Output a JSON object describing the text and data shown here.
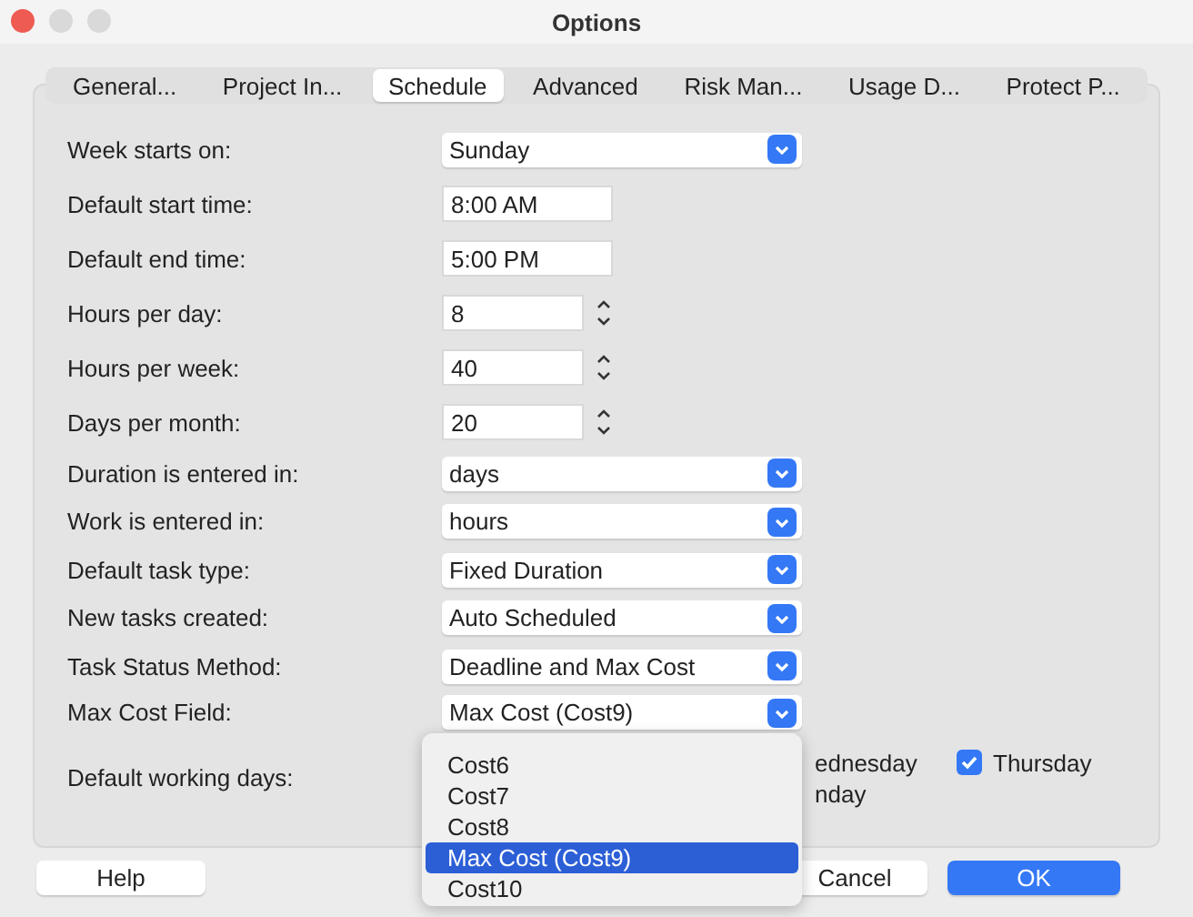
{
  "window": {
    "title": "Options"
  },
  "tabs": [
    {
      "label": "General...",
      "selected": false
    },
    {
      "label": "Project In...",
      "selected": false
    },
    {
      "label": "Schedule",
      "selected": true
    },
    {
      "label": "Advanced",
      "selected": false
    },
    {
      "label": "Risk Man...",
      "selected": false
    },
    {
      "label": "Usage D...",
      "selected": false
    },
    {
      "label": "Protect P...",
      "selected": false
    }
  ],
  "fields": [
    {
      "label": "Week starts on:",
      "kind": "select",
      "value": "Sunday"
    },
    {
      "label": "Default start time:",
      "kind": "text",
      "value": "8:00 AM"
    },
    {
      "label": "Default end time:",
      "kind": "text",
      "value": "5:00 PM"
    },
    {
      "label": "Hours per day:",
      "kind": "number",
      "value": "8"
    },
    {
      "label": "Hours per week:",
      "kind": "number",
      "value": "40"
    },
    {
      "label": "Days per month:",
      "kind": "number",
      "value": "20"
    },
    {
      "label": "Duration is entered in:",
      "kind": "select",
      "value": "days"
    },
    {
      "label": "Work is entered in:",
      "kind": "select",
      "value": "hours"
    },
    {
      "label": "Default task type:",
      "kind": "select",
      "value": "Fixed Duration"
    },
    {
      "label": "New tasks created:",
      "kind": "select",
      "value": "Auto Scheduled"
    },
    {
      "label": "Task Status Method:",
      "kind": "select",
      "value": "Deadline and Max Cost"
    },
    {
      "label": "Max Cost Field:",
      "kind": "select",
      "value": "Max Cost (Cost9)"
    }
  ],
  "working_days": {
    "label": "Default working days:",
    "partial_labels": [
      "ednesday",
      "nday"
    ],
    "days": [
      {
        "label": "Thursday",
        "checked": true
      }
    ]
  },
  "dropdown_list": [
    {
      "label": "Cost6",
      "selected": false
    },
    {
      "label": "Cost7",
      "selected": false
    },
    {
      "label": "Cost8",
      "selected": false
    },
    {
      "label": "Max Cost (Cost9)",
      "selected": true
    },
    {
      "label": "Cost10",
      "selected": false
    }
  ],
  "buttons": [
    {
      "label": "Help",
      "kind": "plain"
    },
    {
      "label": "Cancel",
      "kind": "plain"
    },
    {
      "label": "OK",
      "kind": "primary"
    }
  ]
}
